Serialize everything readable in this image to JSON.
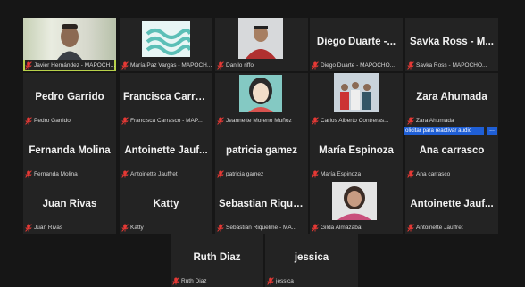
{
  "tiles": [
    {
      "name": "Javier Hernández - MAPOCHO...",
      "display": "",
      "kind": "video"
    },
    {
      "name": "María Paz Vargas - MAPOCH...",
      "display": "",
      "kind": "logo"
    },
    {
      "name": "Danilo riffo",
      "display": "",
      "kind": "video"
    },
    {
      "name": "Diego Duarte - MAPOCHO...",
      "display": "Diego Duarte -...",
      "kind": "text"
    },
    {
      "name": "Savka Ross - MAPOCHO...",
      "display": "Savka Ross - M...",
      "kind": "text"
    },
    {
      "name": "Pedro Garrido",
      "display": "Pedro Garrido",
      "kind": "text"
    },
    {
      "name": "Francisca Carrasco - MAP...",
      "display": "Francisca Carras...",
      "kind": "text"
    },
    {
      "name": "Jeannette Moreno Muñoz",
      "display": "",
      "kind": "avatar"
    },
    {
      "name": "Carlos Alberto Contreras...",
      "display": "",
      "kind": "group"
    },
    {
      "name": "Zara Ahumada",
      "display": "Zara Ahumada",
      "kind": "text"
    },
    {
      "name": "Fernanda Molina",
      "display": "Fernanda Molina",
      "kind": "text"
    },
    {
      "name": "Antoinette Jauffret",
      "display": "Antoinette Jauf...",
      "kind": "text"
    },
    {
      "name": "patricia gamez",
      "display": "patricia gamez",
      "kind": "text"
    },
    {
      "name": "María Espinoza",
      "display": "María Espinoza",
      "kind": "text"
    },
    {
      "name": "Ana carrasco",
      "display": "Ana carrasco",
      "kind": "text"
    },
    {
      "name": "Juan Rivas",
      "display": "Juan Rivas",
      "kind": "text"
    },
    {
      "name": "Katty",
      "display": "Katty",
      "kind": "text"
    },
    {
      "name": "Sebastian Riquelme - MA...",
      "display": "Sebastian Rique...",
      "kind": "text"
    },
    {
      "name": "Gilda Almazabal",
      "display": "",
      "kind": "portrait"
    },
    {
      "name": "Antoinette Jauffret",
      "display": "Antoinette Jauf...",
      "kind": "text"
    },
    {
      "name": "Ruth Diaz",
      "display": "Ruth Diaz",
      "kind": "text"
    },
    {
      "name": "jessica",
      "display": "jessica",
      "kind": "text"
    }
  ],
  "banner": {
    "text": "olicitar para reactivar audio",
    "more": "..."
  },
  "colors": {
    "active_outline": "#b8d14a",
    "muted_mic": "#e53935",
    "banner": "#1f5fd6"
  }
}
